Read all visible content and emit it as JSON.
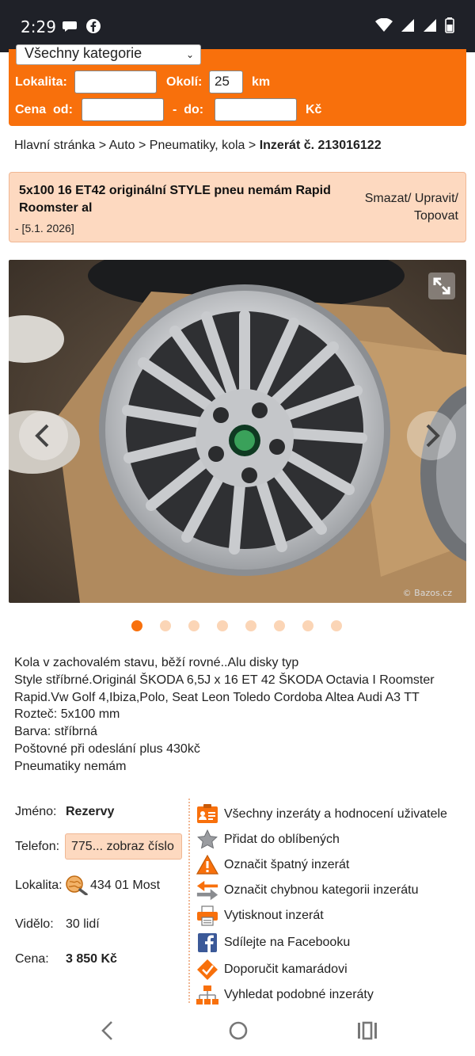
{
  "status_bar": {
    "time": "2:29"
  },
  "search": {
    "category_value": "Všechny kategorie",
    "lokalita_label": "Lokalita:",
    "lokalita_value": "",
    "okoli_label": "Okolí:",
    "okoli_value": "25",
    "okoli_unit": "km",
    "cena_od_label": "Cena  od:",
    "cena_od_value": "",
    "cena_do_label": "-  do:",
    "cena_do_value": "",
    "currency": "Kč"
  },
  "breadcrumb": {
    "home": "Hlavní stránka",
    "sep": ">",
    "auto": "Auto",
    "category": "Pneumatiky, kola",
    "current": "Inzerát č. 213016122"
  },
  "listing": {
    "title": "5x100 16 ET42 originální STYLE pneu nemám Rapid Roomster al",
    "date": "- [5.1. 2026]",
    "actions": "Smazat/ Upravit/ Topovat"
  },
  "gallery": {
    "watermark": "© Bazos.cz",
    "image_count": 8,
    "active_index": 0
  },
  "description": [
    "Kola v zachovalém stavu, běží rovné..Alu disky typ",
    "Style stříbrné.Originál ŠKODA 6,5J x 16 ET 42 ŠKODA Octavia I Roomster",
    "Rapid.Vw Golf 4,Ibiza,Polo, Seat Leon Toledo Cordoba Altea Audi A3 TT",
    "Rozteč: 5x100 mm",
    "Barva: stříbrná",
    "Poštovné při odeslání plus 430kč",
    "Pneumatiky nemám"
  ],
  "details": {
    "jmeno_label": "Jméno:",
    "jmeno_value": "Rezervy",
    "telefon_label": "Telefon:",
    "telefon_value": "775... zobraz číslo",
    "lokalita_label": "Lokalita:",
    "lokalita_value": "434 01 Most",
    "videlo_label": "Vidělo:",
    "videlo_value": "30 lidí",
    "cena_label": "Cena:",
    "cena_value": "3 850 Kč"
  },
  "actions": [
    {
      "icon": "user-list-icon",
      "label": "Všechny inzeráty a hodnocení uživatele"
    },
    {
      "icon": "star-icon",
      "label": "Přidat do oblíbených"
    },
    {
      "icon": "warning-icon",
      "label": "Označit špatný inzerát"
    },
    {
      "icon": "swap-arrows-icon",
      "label": "Označit chybnou kategorii inzerátu"
    },
    {
      "icon": "printer-icon",
      "label": "Vytisknout inzerát"
    },
    {
      "icon": "facebook-icon",
      "label": "Sdílejte na Facebooku"
    },
    {
      "icon": "recommend-icon",
      "label": "Doporučit kamarádovi"
    },
    {
      "icon": "sitemap-icon",
      "label": "Vyhledat podobné inzeráty"
    }
  ],
  "colors": {
    "accent": "#f8700c",
    "panel": "#fdd9c0",
    "statusbar": "#1f2128"
  }
}
